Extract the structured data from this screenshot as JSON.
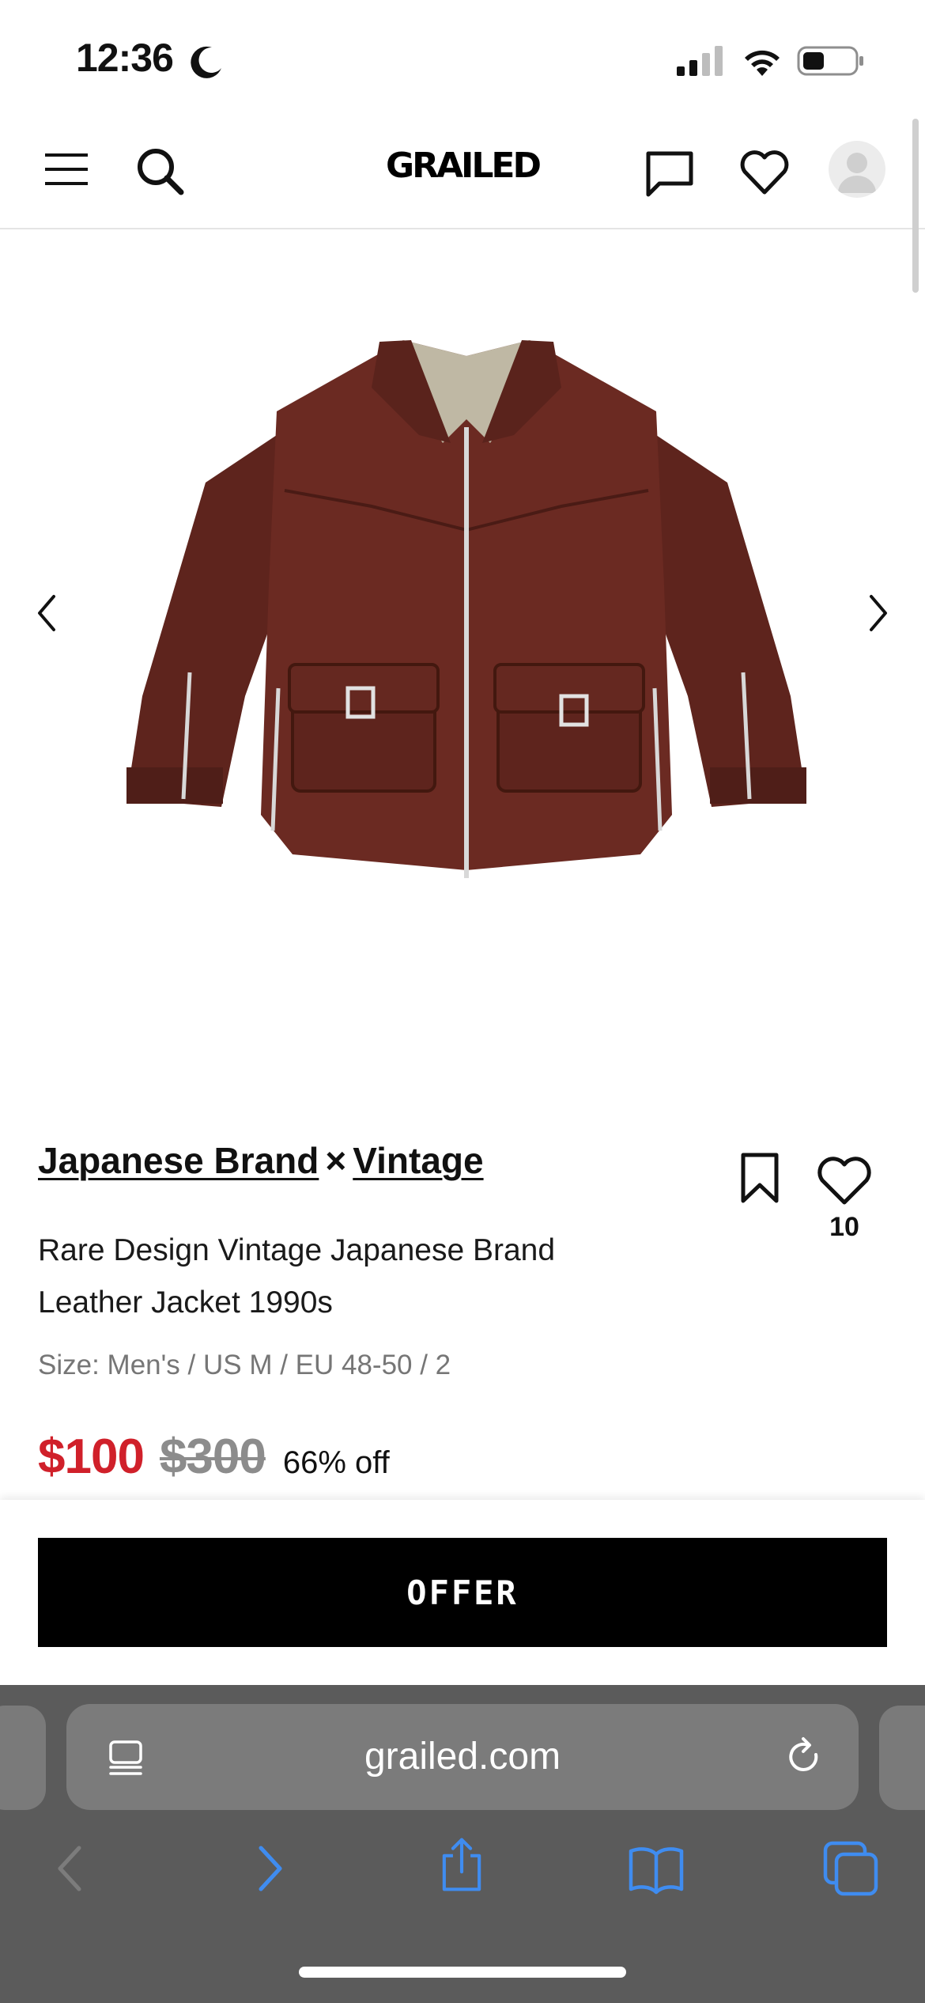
{
  "status_bar": {
    "time": "12:36",
    "icons": [
      "moon-icon",
      "signal-icon",
      "wifi-icon",
      "battery-icon"
    ]
  },
  "header": {
    "logo": "GRAILED",
    "icons": [
      "menu-icon",
      "search-icon",
      "chat-icon",
      "heart-icon",
      "avatar-icon"
    ]
  },
  "gallery": {
    "icons": [
      "chevron-left-icon",
      "chevron-right-icon"
    ]
  },
  "product": {
    "designers": [
      "Japanese Brand",
      "Vintage"
    ],
    "designer_separator": "×",
    "title": "Rare Design Vintage Japanese Brand Leather Jacket 1990s",
    "size": "Size: Men's / US M / EU 48-50 / 2",
    "price_current": "$100",
    "price_original": "$300",
    "discount": "66% off",
    "like_count": "10"
  },
  "offer": {
    "button_label": "OFFER"
  },
  "browser": {
    "address": "grailed.com",
    "icons": [
      "reader-icon",
      "reload-icon",
      "back-icon",
      "forward-icon",
      "share-icon",
      "bookmarks-icon",
      "tabs-icon"
    ]
  },
  "colors": {
    "price_sale": "#d0202a",
    "price_original": "#8c8c8c",
    "offer_button_bg": "#000000",
    "safari_bar": "#5b5b5b",
    "safari_accent": "#3f8cf0",
    "jacket_leather": "#6b2a22"
  }
}
